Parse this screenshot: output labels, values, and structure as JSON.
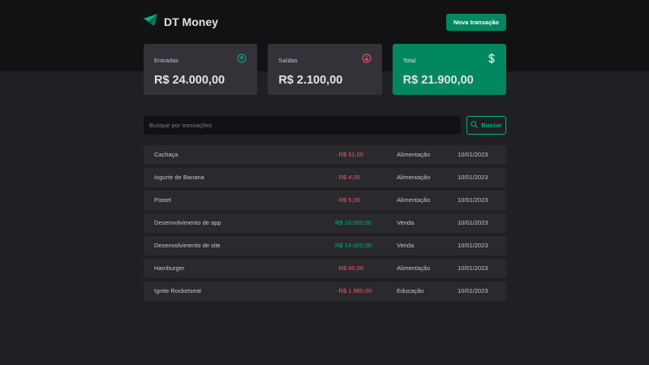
{
  "header": {
    "title": "DT Money",
    "new_transaction_label": "Nova transação"
  },
  "summary": {
    "income": {
      "label": "Entradas",
      "value": "R$ 24.000,00"
    },
    "outcome": {
      "label": "Saídas",
      "value": "R$ 2.100,00"
    },
    "total": {
      "label": "Total",
      "value": "R$ 21.900,00"
    }
  },
  "search": {
    "placeholder": "Busque por transações",
    "button_label": "Buscar"
  },
  "transactions": [
    {
      "description": "Cachaça",
      "price": "- R$ 51,00",
      "type": "outcome",
      "category": "Alimentação",
      "date": "10/01/2023"
    },
    {
      "description": "Iogurte de Banana",
      "price": "- R$ 4,00",
      "type": "outcome",
      "category": "Alimentação",
      "date": "10/01/2023"
    },
    {
      "description": "Pastel",
      "price": "- R$ 5,00",
      "type": "outcome",
      "category": "Alimentação",
      "date": "10/01/2023"
    },
    {
      "description": "Desenvolvimento de app",
      "price": "R$ 10.000,00",
      "type": "income",
      "category": "Venda",
      "date": "10/01/2023"
    },
    {
      "description": "Desenvolvimento de site",
      "price": "R$ 14.000,00",
      "type": "income",
      "category": "Venda",
      "date": "10/01/2023"
    },
    {
      "description": "Hamburger",
      "price": "- R$ 60,00",
      "type": "outcome",
      "category": "Alimentação",
      "date": "10/01/2023"
    },
    {
      "description": "Ignite Rocketseat",
      "price": "- R$ 1.980,00",
      "type": "outcome",
      "category": "Educação",
      "date": "10/01/2023"
    }
  ],
  "icons": {
    "logo": "paper-plane-logo-icon",
    "income": "arrow-circle-up-icon",
    "outcome": "arrow-circle-down-icon",
    "total": "dollar-sign-icon",
    "search": "magnifying-glass-icon"
  },
  "colors": {
    "background": "#202024",
    "header": "#121214",
    "card": "#323238",
    "row": "#29292E",
    "brand": "#00875F",
    "income": "#00B37E",
    "outcome": "#F75A68"
  }
}
